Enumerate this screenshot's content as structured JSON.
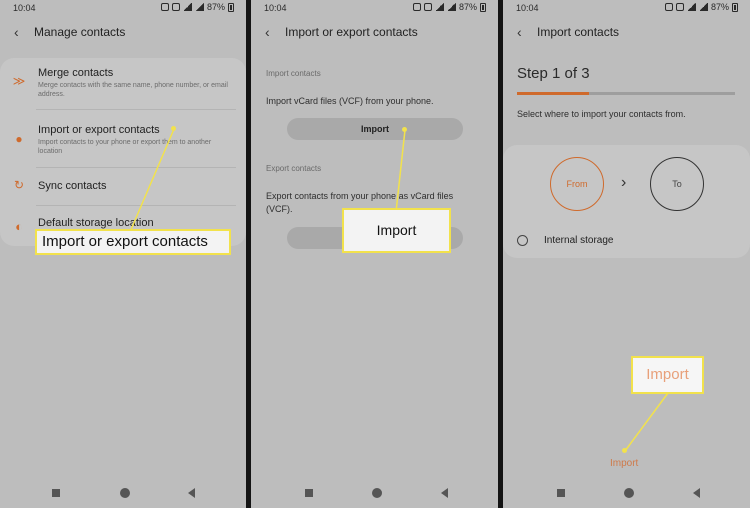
{
  "status": {
    "time": "10:04",
    "battery": "87%"
  },
  "panel1": {
    "title": "Manage contacts",
    "items": [
      {
        "title": "Merge contacts",
        "subtitle": "Merge contacts with the same name, phone number, or email address.",
        "icon": "merge-icon"
      },
      {
        "title": "Import or export contacts",
        "subtitle": "Import contacts to your phone or export them to another location",
        "icon": "import-export-icon"
      },
      {
        "title": "Sync contacts",
        "subtitle": "",
        "icon": "sync-icon"
      },
      {
        "title": "Default storage location",
        "subtitle": "",
        "icon": "storage-icon"
      }
    ],
    "callout": "Import or export contacts"
  },
  "panel2": {
    "title": "Import or export contacts",
    "import_section": "Import contacts",
    "import_desc": "Import vCard files (VCF) from your phone.",
    "import_button": "Import",
    "export_section": "Export contacts",
    "export_desc": "Export contacts from your phone as vCard files (VCF).",
    "callout": "Import"
  },
  "panel3": {
    "title": "Import contacts",
    "step": "Step 1 of 3",
    "progress": 0.33,
    "instruction": "Select where to import your contacts from.",
    "from_label": "From",
    "to_label": "To",
    "storage_option": "Internal storage",
    "import_button": "Import",
    "callout": "Import"
  },
  "colors": {
    "accent": "#cf6a2c",
    "callout_border": "#f2e24c",
    "screen_bg": "#bdbdbd"
  }
}
